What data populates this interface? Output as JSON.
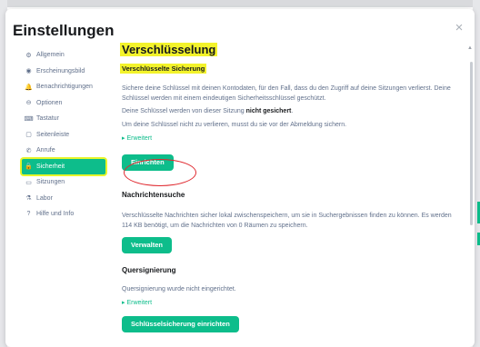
{
  "dialog": {
    "title": "Einstellungen",
    "close_glyph": "×"
  },
  "sidebar": {
    "items": [
      {
        "label": "Allgemein",
        "icon": "gear-icon",
        "glyph": "⚙"
      },
      {
        "label": "Erscheinungsbild",
        "icon": "eye-icon",
        "glyph": "◉"
      },
      {
        "label": "Benachrichtigungen",
        "icon": "bell-icon",
        "glyph": "🔔"
      },
      {
        "label": "Optionen",
        "icon": "options-icon",
        "glyph": "⊖"
      },
      {
        "label": "Tastatur",
        "icon": "keyboard-icon",
        "glyph": "⌨"
      },
      {
        "label": "Seitenleiste",
        "icon": "sidebar-icon",
        "glyph": "▢"
      },
      {
        "label": "Anrufe",
        "icon": "phone-icon",
        "glyph": "✆"
      },
      {
        "label": "Sicherheit",
        "icon": "lock-icon",
        "glyph": "🔒",
        "active": true
      },
      {
        "label": "Sitzungen",
        "icon": "devices-icon",
        "glyph": "▭"
      },
      {
        "label": "Labor",
        "icon": "flask-icon",
        "glyph": "⚗"
      },
      {
        "label": "Hilfe und Info",
        "icon": "help-icon",
        "glyph": "?"
      }
    ]
  },
  "encryption": {
    "title": "Verschlüsselung",
    "backup_heading": "Verschlüsselte Sicherung",
    "backup_text": "Sichere deine Schlüssel mit deinen Kontodaten, für den Fall, dass du den Zugriff auf deine Sitzungen verlierst. Deine Schlüssel werden mit einem eindeutigen Sicherheitsschlüssel geschützt.",
    "backup_status_prefix": "Deine Schlüssel werden von dieser Sitzung",
    "backup_status_bold": "nicht gesichert",
    "backup_status_suffix": ".",
    "backup_hint": "Um deine Schlüssel nicht zu verlieren, musst du sie vor der Abmeldung sichern.",
    "advanced_label": "▸ Erweitert",
    "setup_button": "Einrichten"
  },
  "message_search": {
    "heading": "Nachrichtensuche",
    "text": "Verschlüsselte Nachrichten sicher lokal zwischenspeichern, um sie in Suchergebnissen finden zu können. Es werden 114 KB benötigt, um die Nachrichten von 0 Räumen zu speichern.",
    "manage_button": "Verwalten"
  },
  "cross_signing": {
    "heading": "Quersignierung",
    "text": "Quersignierung wurde nicht eingerichtet.",
    "advanced_label": "▸ Erweitert",
    "setup_button": "Schlüsselsicherung einrichten"
  },
  "colors": {
    "accent": "#0dbd8b",
    "highlight": "#f3f32b",
    "annotation_circle": "#e0292f"
  }
}
